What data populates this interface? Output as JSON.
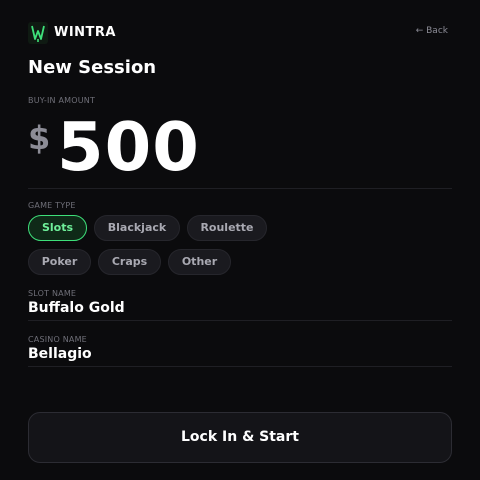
{
  "brand": {
    "name": "WINTRA",
    "accent": "#3ee07a"
  },
  "header": {
    "back_label": "← Back"
  },
  "page": {
    "title": "New Session"
  },
  "buyin": {
    "label": "BUY-IN AMOUNT",
    "currency_symbol": "$",
    "amount": "500"
  },
  "game_type": {
    "label": "GAME TYPE",
    "options": [
      "Slots",
      "Blackjack",
      "Roulette",
      "Poker",
      "Craps",
      "Other"
    ],
    "selected": "Slots"
  },
  "slot_name": {
    "label": "SLOT NAME",
    "value": "Buffalo Gold"
  },
  "casino_name": {
    "label": "CASINO NAME",
    "value": "Bellagio"
  },
  "cta": {
    "label": "Lock In & Start"
  },
  "icons": {
    "logo": "wintra-logo-icon"
  }
}
